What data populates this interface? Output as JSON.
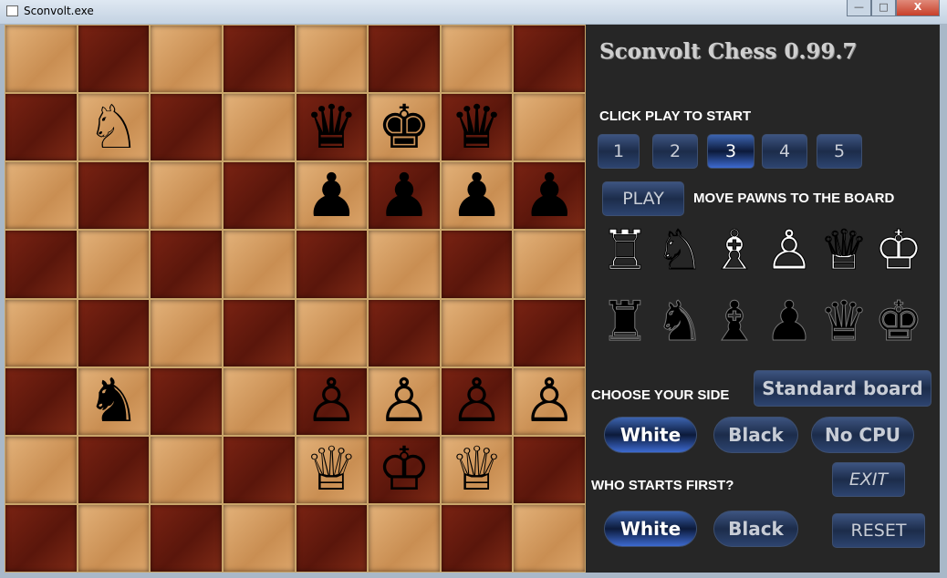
{
  "window": {
    "title": "Sconvolt.exe",
    "minimize": "—",
    "maximize": "□",
    "close": "X"
  },
  "board": [
    [
      "",
      "",
      "",
      "",
      "",
      "",
      "",
      ""
    ],
    [
      "",
      "♘",
      "",
      "",
      "♛",
      "♚",
      "♛",
      ""
    ],
    [
      "",
      "",
      "",
      "",
      "♟",
      "♟",
      "♟",
      "♟"
    ],
    [
      "",
      "",
      "",
      "",
      "",
      "",
      "",
      ""
    ],
    [
      "",
      "",
      "",
      "",
      "",
      "",
      "",
      ""
    ],
    [
      "",
      "♞",
      "",
      "",
      "♙",
      "♙",
      "♙",
      "♙"
    ],
    [
      "",
      "",
      "",
      "",
      "♕",
      "♔",
      "♕",
      ""
    ],
    [
      "",
      "",
      "",
      "",
      "",
      "",
      "",
      ""
    ]
  ],
  "panel": {
    "title": "Sconvolt Chess 0.99.7",
    "click_play": "CLICK PLAY TO START",
    "levels": [
      "1",
      "2",
      "3",
      "4",
      "5"
    ],
    "selected_level": "3",
    "play": "PLAY",
    "move_pawns": "MOVE PAWNS TO THE BOARD",
    "white_pieces": [
      "♖",
      "♘",
      "♗",
      "♙",
      "♕",
      "♔"
    ],
    "black_pieces": [
      "♜",
      "♞",
      "♝",
      "♟",
      "♛",
      "♚"
    ],
    "choose_side": "CHOOSE YOUR SIDE",
    "standard_board": "Standard board",
    "side_options": [
      "White",
      "Black",
      "No CPU"
    ],
    "selected_side": "White",
    "who_starts": "WHO STARTS FIRST?",
    "start_options": [
      "White",
      "Black"
    ],
    "selected_start": "White",
    "exit": "EXIT",
    "reset": "RESET"
  },
  "colors": {
    "panel": "#262626",
    "button": "#1c2c4a",
    "selected": "#3d6ad0"
  }
}
